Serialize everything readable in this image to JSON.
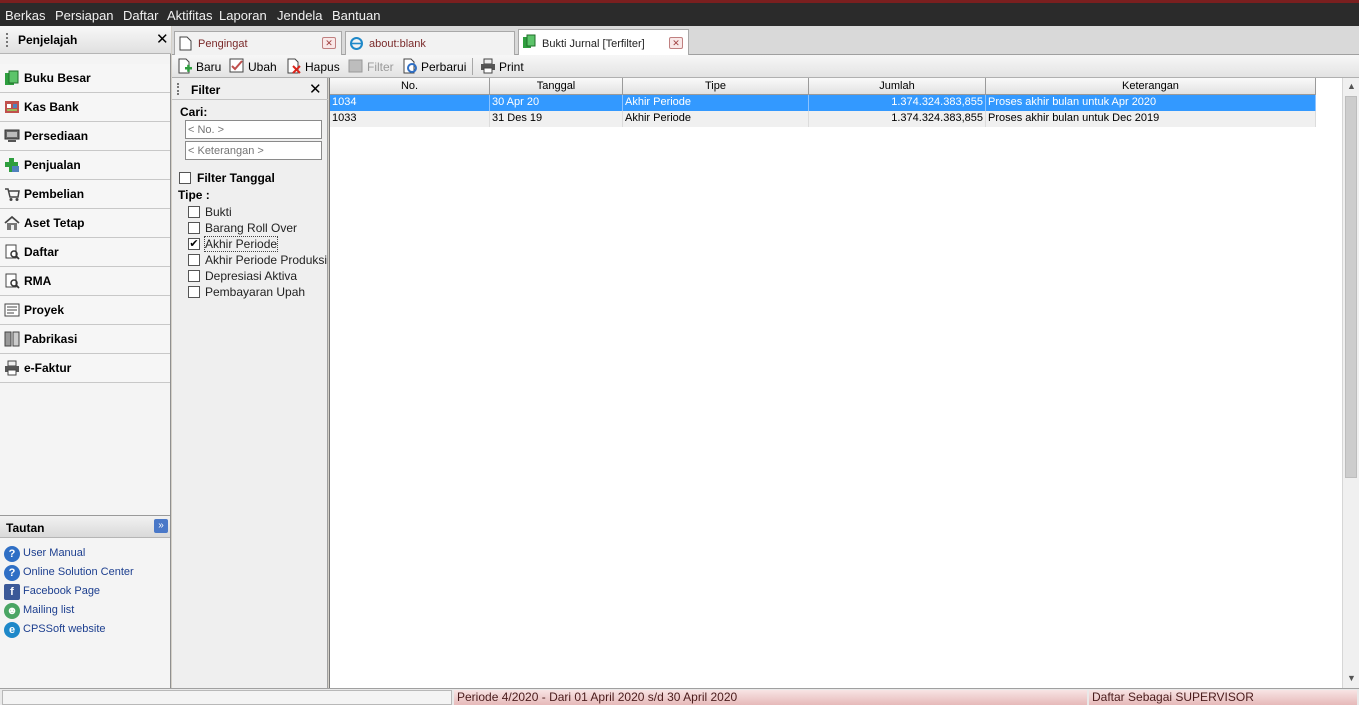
{
  "menu": [
    "Berkas",
    "Persiapan",
    "Daftar",
    "Aktifitas",
    "Laporan",
    "Jendela",
    "Bantuan"
  ],
  "navigator": {
    "title": "Penjelajah",
    "items": [
      {
        "label": "Buku Besar",
        "icon": "ledger-icon"
      },
      {
        "label": "Kas Bank",
        "icon": "bank-icon"
      },
      {
        "label": "Persediaan",
        "icon": "inventory-icon"
      },
      {
        "label": "Penjualan",
        "icon": "sales-icon"
      },
      {
        "label": "Pembelian",
        "icon": "cart-icon"
      },
      {
        "label": "Aset Tetap",
        "icon": "house-icon"
      },
      {
        "label": "Daftar",
        "icon": "list-icon"
      },
      {
        "label": "RMA",
        "icon": "rma-icon"
      },
      {
        "label": "Proyek",
        "icon": "project-icon"
      },
      {
        "label": "Pabrikasi",
        "icon": "factory-icon"
      },
      {
        "label": "e-Faktur",
        "icon": "printer-icon"
      }
    ]
  },
  "tautan": {
    "title": "Tautan",
    "links": [
      {
        "label": "User Manual",
        "icon": "help-icon"
      },
      {
        "label": "Online Solution Center",
        "icon": "help-icon"
      },
      {
        "label": "Facebook Page",
        "icon": "facebook-icon"
      },
      {
        "label": "Mailing list",
        "icon": "people-icon"
      },
      {
        "label": "CPSSoft website",
        "icon": "ie-icon"
      }
    ]
  },
  "tabs": [
    {
      "label": "Pengingat",
      "active": false
    },
    {
      "label": "about:blank",
      "active": false
    },
    {
      "label": "Bukti Jurnal [Terfilter]",
      "active": true
    }
  ],
  "toolbar": {
    "baru": "Baru",
    "ubah": "Ubah",
    "hapus": "Hapus",
    "filter": "Filter",
    "perbarui": "Perbarui",
    "print": "Print"
  },
  "filter": {
    "title": "Filter",
    "cari_label": "Cari:",
    "no_placeholder": "< No. >",
    "keterangan_placeholder": "< Keterangan >",
    "filter_tanggal": "Filter Tanggal",
    "filter_tanggal_checked": false,
    "tipe_label": "Tipe :",
    "tipe_options": [
      {
        "label": "Bukti",
        "checked": false
      },
      {
        "label": "Barang Roll Over",
        "checked": false
      },
      {
        "label": "Akhir Periode",
        "checked": true
      },
      {
        "label": "Akhir Periode Produksi",
        "checked": false
      },
      {
        "label": "Depresiasi Aktiva",
        "checked": false
      },
      {
        "label": "Pembayaran Upah",
        "checked": false
      }
    ]
  },
  "grid": {
    "columns": [
      "No.",
      "Tanggal",
      "Tipe",
      "Jumlah",
      "Keterangan"
    ],
    "rows": [
      {
        "no": "1034",
        "tanggal": "30 Apr 20",
        "tipe": "Akhir Periode",
        "jumlah": "1.374.324.383,855",
        "keterangan": "Proses akhir bulan untuk Apr 2020",
        "selected": true
      },
      {
        "no": "1033",
        "tanggal": "31 Des 19",
        "tipe": "Akhir Periode",
        "jumlah": "1.374.324.383,855",
        "keterangan": "Proses akhir bulan untuk Dec 2019",
        "selected": false
      }
    ]
  },
  "status": {
    "left": "",
    "periode": "Periode 4/2020 - Dari 01 April 2020 s/d 30 April 2020",
    "user": "Daftar Sebagai SUPERVISOR"
  },
  "colors": {
    "selection": "#3399ff",
    "menubar": "#2b2b2b",
    "status_accent": "#e6b9b9"
  }
}
